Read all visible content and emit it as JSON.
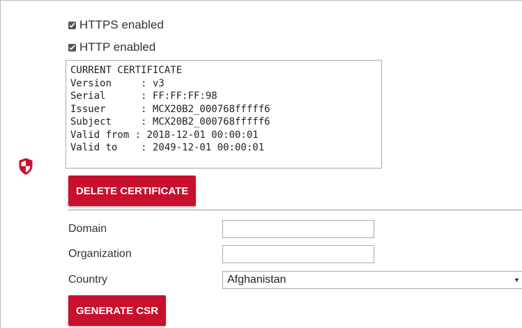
{
  "security": {
    "https_label": "HTTPS enabled",
    "https_checked": true,
    "http_label": "HTTP enabled",
    "http_checked": true
  },
  "certificate": {
    "text": "CURRENT CERTIFICATE\nVersion     : v3\nSerial      : FF:FF:FF:98\nIssuer      : MCX20B2_000768fffff6\nSubject     : MCX20B2_000768fffff6\nValid from : 2018-12-01 00:00:01\nValid to    : 2049-12-01 00:00:01",
    "delete_button": "DELETE CERTIFICATE"
  },
  "csr_form": {
    "domain_label": "Domain",
    "domain_value": "",
    "organization_label": "Organization",
    "organization_value": "",
    "country_label": "Country",
    "country_value": "Afghanistan",
    "generate_button": "GENERATE CSR"
  },
  "icons": {
    "shield": "shield-icon"
  },
  "colors": {
    "accent": "#c8102e",
    "border": "#a9a9a9",
    "text": "#333333"
  }
}
